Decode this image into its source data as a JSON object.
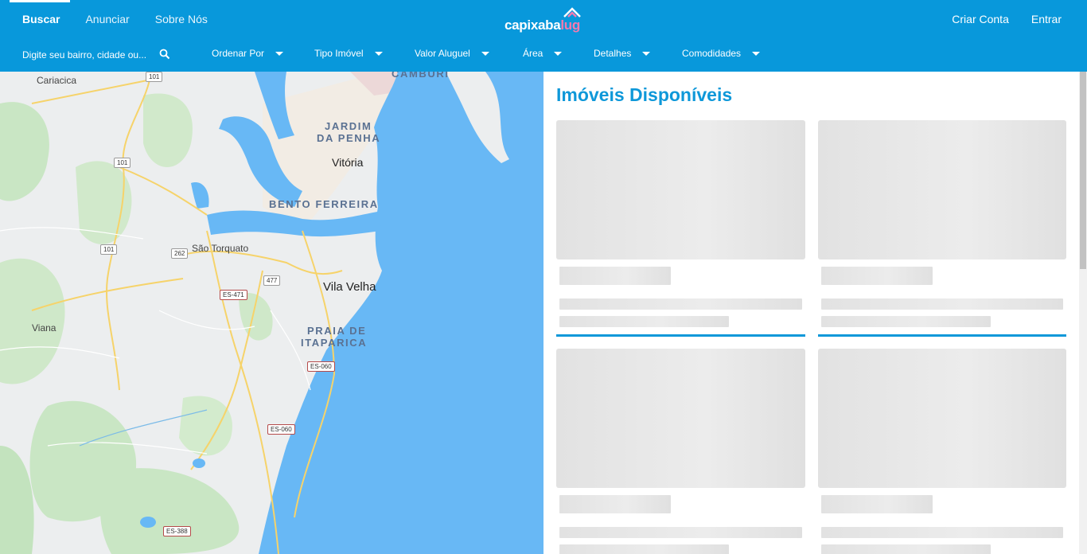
{
  "header": {
    "nav": [
      "Buscar",
      "Anunciar",
      "Sobre Nós"
    ],
    "logo": {
      "main": "capixaba",
      "accent": "lug"
    },
    "right_nav": [
      "Criar Conta",
      "Entrar"
    ]
  },
  "filters": {
    "search_placeholder": "Digite seu bairro, cidade ou...",
    "items": [
      "Ordenar Por",
      "Tipo Imóvel",
      "Valor Aluguel",
      "Área",
      "Detalhes",
      "Comodidades"
    ]
  },
  "map": {
    "labels": {
      "cariacica": "Cariacica",
      "camburi": "CAMBURI",
      "jardim_da_penha_1": "JARDIM",
      "jardim_da_penha_2": "DA PENHA",
      "vitoria": "Vitória",
      "bento_ferreira": "BENTO FERREIRA",
      "sao_torquato": "São Torquato",
      "vila_velha": "Vila Velha",
      "viana": "Viana",
      "praia_itaparica_1": "PRAIA DE",
      "praia_itaparica_2": "ITAPARICA"
    },
    "shields": {
      "r101_a": "101",
      "r101_b": "101",
      "r101_c": "101",
      "r262": "262",
      "r477": "477",
      "es471": "ES-471",
      "es060_a": "ES-060",
      "es060_b": "ES-060",
      "es388": "ES-388"
    }
  },
  "listing": {
    "title": "Imóveis Disponíveis"
  },
  "colors": {
    "brand_blue": "#0898db",
    "title_blue": "#0e98d9",
    "logo_pink": "#f27ab0",
    "water": "#68b8f5"
  }
}
